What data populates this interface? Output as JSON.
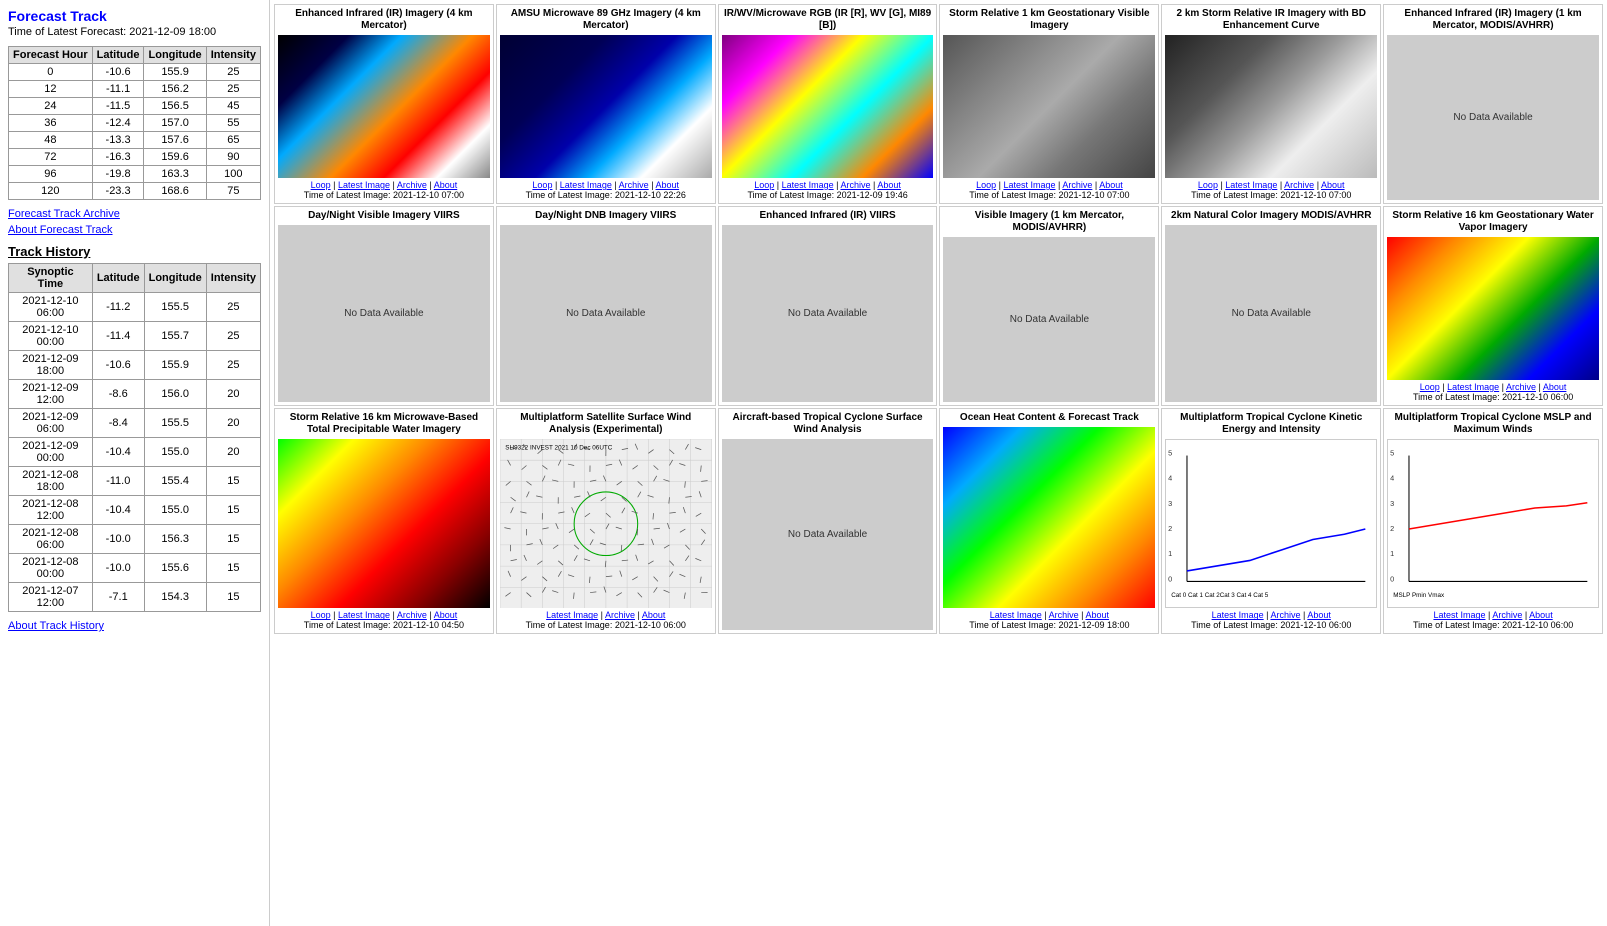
{
  "left": {
    "forecast_track_title": "Forecast Track",
    "latest_forecast_label": "Time of Latest Forecast:",
    "latest_forecast_time": "2021-12-09 18:00",
    "forecast_table": {
      "headers": [
        "Forecast Hour",
        "Latitude",
        "Longitude",
        "Intensity"
      ],
      "rows": [
        [
          "0",
          "-10.6",
          "155.9",
          "25"
        ],
        [
          "12",
          "-11.1",
          "156.2",
          "25"
        ],
        [
          "24",
          "-11.5",
          "156.5",
          "45"
        ],
        [
          "36",
          "-12.4",
          "157.0",
          "55"
        ],
        [
          "48",
          "-13.3",
          "157.6",
          "65"
        ],
        [
          "72",
          "-16.3",
          "159.6",
          "90"
        ],
        [
          "96",
          "-19.8",
          "163.3",
          "100"
        ],
        [
          "120",
          "-23.3",
          "168.6",
          "75"
        ]
      ]
    },
    "forecast_track_archive": "Forecast Track Archive",
    "about_forecast_track": "About Forecast Track",
    "track_history_title": "Track History",
    "track_history_table": {
      "headers": [
        "Synoptic Time",
        "Latitude",
        "Longitude",
        "Intensity"
      ],
      "rows": [
        [
          "2021-12-10 06:00",
          "-11.2",
          "155.5",
          "25"
        ],
        [
          "2021-12-10 00:00",
          "-11.4",
          "155.7",
          "25"
        ],
        [
          "2021-12-09 18:00",
          "-10.6",
          "155.9",
          "25"
        ],
        [
          "2021-12-09 12:00",
          "-8.6",
          "156.0",
          "20"
        ],
        [
          "2021-12-09 06:00",
          "-8.4",
          "155.5",
          "20"
        ],
        [
          "2021-12-09 00:00",
          "-10.4",
          "155.0",
          "20"
        ],
        [
          "2021-12-08 18:00",
          "-11.0",
          "155.4",
          "15"
        ],
        [
          "2021-12-08 12:00",
          "-10.4",
          "155.0",
          "15"
        ],
        [
          "2021-12-08 06:00",
          "-10.0",
          "156.3",
          "15"
        ],
        [
          "2021-12-08 00:00",
          "-10.0",
          "155.6",
          "15"
        ],
        [
          "2021-12-07 12:00",
          "-7.1",
          "154.3",
          "15"
        ]
      ]
    },
    "about_track_history": "About Track History"
  },
  "grid": {
    "cells": [
      {
        "title": "Enhanced Infrared (IR) Imagery\n(4 km Mercator)",
        "type": "ir-colored",
        "links": [
          "Loop",
          "Latest Image",
          "Archive",
          "About"
        ],
        "time": "Time of Latest Image: 2021-12-10 07:00",
        "no_data": false
      },
      {
        "title": "AMSU Microwave 89 GHz\nImagery (4 km Mercator)",
        "type": "amsu",
        "links": [
          "Loop",
          "Latest Image",
          "Archive",
          "About"
        ],
        "time": "Time of Latest Image: 2021-12-10 22:26",
        "no_data": false
      },
      {
        "title": "IR/WV/Microwave RGB (IR [R],\nWV [G], MI89 [B])",
        "type": "rgb-ir",
        "links": [
          "Loop",
          "Latest Image",
          "Archive",
          "About"
        ],
        "time": "Time of Latest Image: 2021-12-09 19:46",
        "no_data": false
      },
      {
        "title": "Storm Relative 1 km\nGeostationary Visible Imagery",
        "type": "vis-gray",
        "links": [
          "Loop",
          "Latest Image",
          "Archive",
          "About"
        ],
        "time": "Time of Latest Image: 2021-12-10 07:00",
        "no_data": false
      },
      {
        "title": "2 km Storm Relative IR Imagery\nwith BD Enhancement Curve",
        "type": "bd-enhancement",
        "links": [
          "Loop",
          "Latest Image",
          "Archive",
          "About"
        ],
        "time": "Time of Latest Image: 2021-12-10 07:00",
        "no_data": false
      },
      {
        "title": "Enhanced Infrared (IR) Imagery\n(1 km Mercator, MODIS/AVHRR)",
        "type": "no-data",
        "links": [],
        "time": "",
        "no_data": true,
        "no_data_text": "No Data Available"
      },
      {
        "title": "Day/Night Visible Imagery VIIRS",
        "type": "no-data",
        "links": [],
        "time": "",
        "no_data": true,
        "no_data_text": "No Data Available"
      },
      {
        "title": "Day/Night DNB Imagery VIIRS",
        "type": "no-data",
        "links": [],
        "time": "",
        "no_data": true,
        "no_data_text": "No Data Available"
      },
      {
        "title": "Enhanced Infrared (IR) VIIRS",
        "type": "no-data",
        "links": [],
        "time": "",
        "no_data": true,
        "no_data_text": "No Data Available"
      },
      {
        "title": "Visible Imagery (1 km Mercator,\nMODIS/AVHRR)",
        "type": "no-data",
        "links": [],
        "time": "",
        "no_data": true,
        "no_data_text": "No Data Available"
      },
      {
        "title": "2km Natural Color Imagery\nMODIS/AVHRR",
        "type": "no-data",
        "links": [],
        "time": "",
        "no_data": true,
        "no_data_text": "No Data Available"
      },
      {
        "title": "Storm Relative 16 km\nGeostationary Water Vapor\nImagery",
        "type": "water-vapor",
        "links": [
          "Loop",
          "Latest Image",
          "Archive",
          "About"
        ],
        "time": "Time of Latest Image: 2021-12-10 06:00",
        "no_data": false
      },
      {
        "title": "Storm Relative 16 km\nMicrowave-Based Total\nPrecipitable Water Imagery",
        "type": "precip",
        "links": [
          "Loop",
          "Latest Image",
          "Archive",
          "About"
        ],
        "time": "Time of Latest Image: 2021-12-10 04:50",
        "no_data": false
      },
      {
        "title": "Multiplatform Satellite Surface\nWind Analysis (Experimental)",
        "type": "wind-analysis",
        "links": [
          "Latest Image",
          "Archive",
          "About"
        ],
        "time": "Time of Latest Image: 2021-12-10 06:00",
        "no_data": false,
        "wind_label": "SH9322    INVEST    2021 10 Dec 06UTC"
      },
      {
        "title": "Aircraft-based Tropical Cyclone\nSurface Wind Analysis",
        "type": "no-data",
        "links": [],
        "time": "",
        "no_data": true,
        "no_data_text": "No Data Available"
      },
      {
        "title": "Ocean Heat Content & Forecast\nTrack",
        "type": "ohc",
        "links": [
          "Latest Image",
          "Archive",
          "About"
        ],
        "time": "Time of Latest Image: 2021-12-09 18:00",
        "no_data": false
      },
      {
        "title": "Multiplatform Tropical Cyclone\nKinetic Energy and Intensity",
        "type": "kinetic",
        "links": [
          "Latest Image",
          "Archive",
          "About"
        ],
        "time": "Time of Latest Image: 2021-12-10 06:00",
        "no_data": false
      },
      {
        "title": "Multiplatform Tropical Cyclone\nMSLP and Maximum Winds",
        "type": "mslp",
        "links": [
          "Latest Image",
          "Archive",
          "About"
        ],
        "time": "Time of Latest Image: 2021-12-10 06:00",
        "no_data": false
      }
    ]
  }
}
